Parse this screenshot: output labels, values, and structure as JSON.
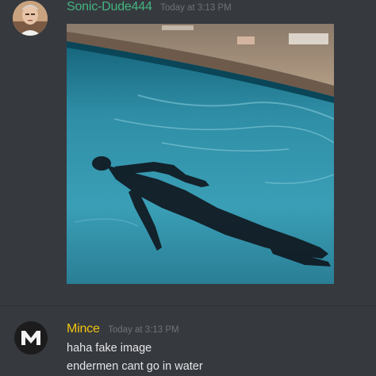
{
  "messages": [
    {
      "username": "Sonic-Dude444",
      "timestamp": "Today at 3:13 PM",
      "username_color": "#43b581",
      "avatar": "user-photo-avatar",
      "attachment": "swimming-pool-image"
    },
    {
      "username": "Mince",
      "timestamp": "Today at 3:13 PM",
      "username_color": "#f1c40f",
      "avatar": "m-logo-avatar",
      "lines": [
        "haha fake image",
        "endermen cant go in water"
      ]
    }
  ],
  "colors": {
    "background": "#36393e",
    "text": "#e4e5e7",
    "timestamp": "#6f7378"
  }
}
